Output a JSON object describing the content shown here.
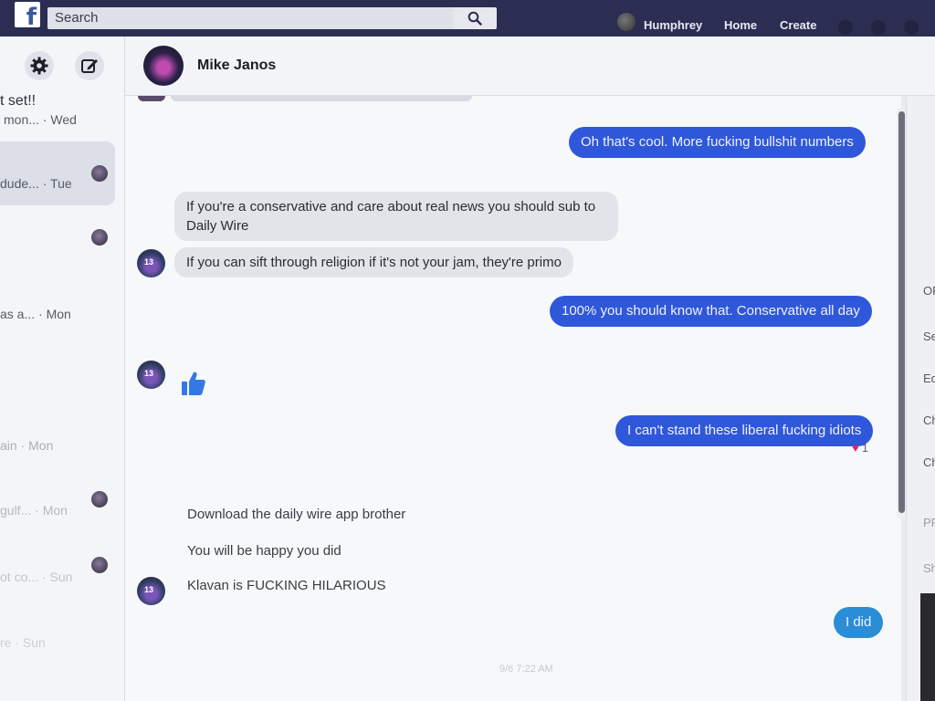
{
  "topbar": {
    "logo": "f",
    "search_placeholder": "Search",
    "user_name": "Humphrey",
    "nav": [
      "Home",
      "Create"
    ]
  },
  "sidebar": {
    "header_title_fragment": "t set!!",
    "conversations": [
      {
        "snippet": "mon...",
        "time": "Wed"
      },
      {
        "snippet": "dude...",
        "time": "Tue"
      },
      {
        "snippet": "as a...",
        "time": "Mon"
      },
      {
        "snippet": "ain",
        "time": "Mon"
      },
      {
        "snippet": "gulf...",
        "time": "Mon"
      },
      {
        "snippet": "ot co...",
        "time": "Sun"
      },
      {
        "snippet": "re",
        "time": "Sun"
      }
    ]
  },
  "chat": {
    "contact_name": "Mike Janos",
    "messages": [
      {
        "dir": "out",
        "text": "Oh that's cool. More fucking bullshit numbers"
      },
      {
        "dir": "in",
        "text": "If you're a conservative and care about real news you should sub to Daily Wire"
      },
      {
        "dir": "in",
        "text": "If you can sift through religion if it's not your jam, they're primo"
      },
      {
        "dir": "out",
        "text": "100% you should know that. Conservative all day"
      },
      {
        "dir": "in",
        "text": "thumbs-up"
      },
      {
        "dir": "out",
        "text": "I can't stand these liberal fucking idiots"
      },
      {
        "dir": "in",
        "text": "Download the daily wire app brother"
      },
      {
        "dir": "in",
        "text": "You will be happy you did"
      },
      {
        "dir": "in",
        "text": "Klavan is FUCKING HILARIOUS"
      },
      {
        "dir": "out",
        "text": "I did"
      }
    ],
    "reaction": {
      "emoji": "♥",
      "count": "1"
    },
    "avatar_jersey": "13",
    "timestamp_faded": "9/6 7:22 AM"
  },
  "right_panel": {
    "labels": [
      "OP",
      "Se",
      "Ed",
      "Ch",
      "Ch",
      "PR",
      "Sh"
    ]
  },
  "colors": {
    "topbar": "#2b2d52",
    "outgoing_bubble": "#2f57d9",
    "incoming_bubble": "#e2e4ea"
  }
}
